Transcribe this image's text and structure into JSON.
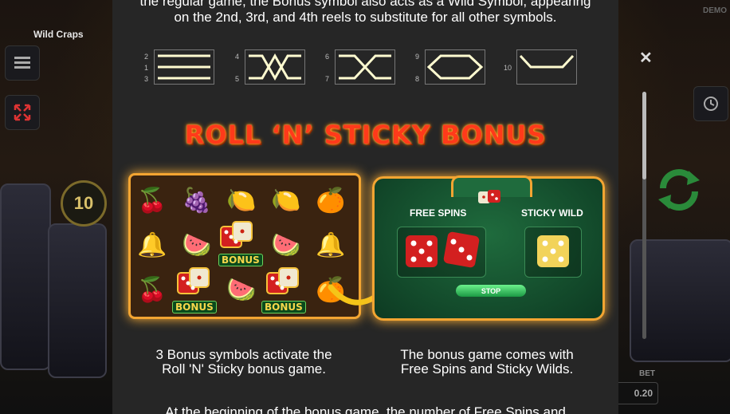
{
  "game": {
    "title": "Wild Craps",
    "demo_label": "DEMO",
    "coin_value": "10",
    "bet_label": "BET",
    "bet_value": "0.20"
  },
  "rules": {
    "intro_lines": [
      "the regular game, the Bonus symbol also acts as a Wild Symbol, appearing",
      "on the 2nd, 3rd, and 4th reels to substitute for all other symbols."
    ],
    "paylines": [
      {
        "left_nums": [
          "2",
          "1",
          "3"
        ],
        "right_nums": []
      },
      {
        "left_nums": [
          "4",
          "5"
        ],
        "right_nums": []
      },
      {
        "left_nums": [
          "6",
          "7"
        ],
        "right_nums": []
      },
      {
        "left_nums": [
          "9",
          "8"
        ],
        "right_nums": []
      },
      {
        "left_nums": [
          "10"
        ],
        "right_nums": []
      }
    ],
    "bonus_title": "ROLL ‘N’ STICKY BONUS",
    "bonus_tag": "BONUS",
    "free_spins_label": "FREE SPINS",
    "sticky_wild_label": "STICKY WILD",
    "stop_label": "STOP",
    "caption_left": [
      "3 Bonus symbols activate the",
      "Roll 'N' Sticky bonus game."
    ],
    "caption_right": [
      "The bonus game comes with",
      "Free Spins and Sticky Wilds."
    ],
    "outro": "At the beginning of the bonus game, the number of Free Spins and"
  },
  "reel_symbols": [
    "🍒",
    "🍇",
    "🍋",
    "🍋",
    "🍊",
    "🔔",
    "🍉",
    "🍉",
    "🍉",
    "🔔",
    "🍒",
    "🍋",
    "🍉",
    "🍒",
    "🍊"
  ],
  "colors": {
    "accent": "#f3a532",
    "title": "#ff3a1a",
    "panel": "#262626"
  }
}
